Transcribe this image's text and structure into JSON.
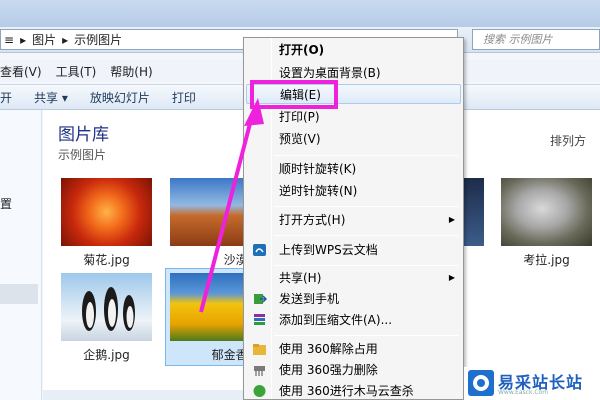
{
  "address": {
    "arrow_left": "≡",
    "crumb1": "图片",
    "sep": "▸",
    "crumb2": "示例图片"
  },
  "search": {
    "placeholder": "搜索 示例图片"
  },
  "menu": [
    "查看(V)",
    "工具(T)",
    "帮助(H)"
  ],
  "toolbar": {
    "left_partial": "开",
    "share": "共享 ▾",
    "slideshow": "放映幻灯片",
    "print_partial": "打印"
  },
  "nav": {
    "partial_item": "置"
  },
  "library": {
    "title": "图片库",
    "subtitle": "示例图片",
    "sort_partial": "排列方"
  },
  "thumbnails": [
    {
      "name": "菊花.jpg"
    },
    {
      "name": "沙漠.jpg"
    },
    {
      "name": "考拉.jpg"
    },
    {
      "name": "企鹅.jpg"
    },
    {
      "name": "郁金香.jpg"
    }
  ],
  "context_menu": {
    "items": [
      {
        "label": "打开(O)",
        "bold": true
      },
      {
        "label": "设置为桌面背景(B)"
      },
      {
        "label": "编辑(E)"
      },
      {
        "label": "打印(P)"
      },
      {
        "label": "预览(V)"
      },
      {
        "label": "顺时针旋转(K)"
      },
      {
        "label": "逆时针旋转(N)"
      },
      {
        "label": "打开方式(H)"
      },
      {
        "label": "上传到WPS云文档"
      },
      {
        "label": "共享(H)"
      },
      {
        "label": "发送到手机"
      },
      {
        "label": "添加到压缩文件(A)..."
      },
      {
        "label": "使用 360解除占用"
      },
      {
        "label": "使用 360强力删除"
      },
      {
        "label": "使用 360进行木马云查杀"
      }
    ],
    "submenu_arrow": "▶"
  },
  "watermark": {
    "text": "易采站长站",
    "url": "Www.Easck.Com"
  },
  "colors": {
    "callout": "#ee22dd",
    "library_title": "#1e3287"
  }
}
